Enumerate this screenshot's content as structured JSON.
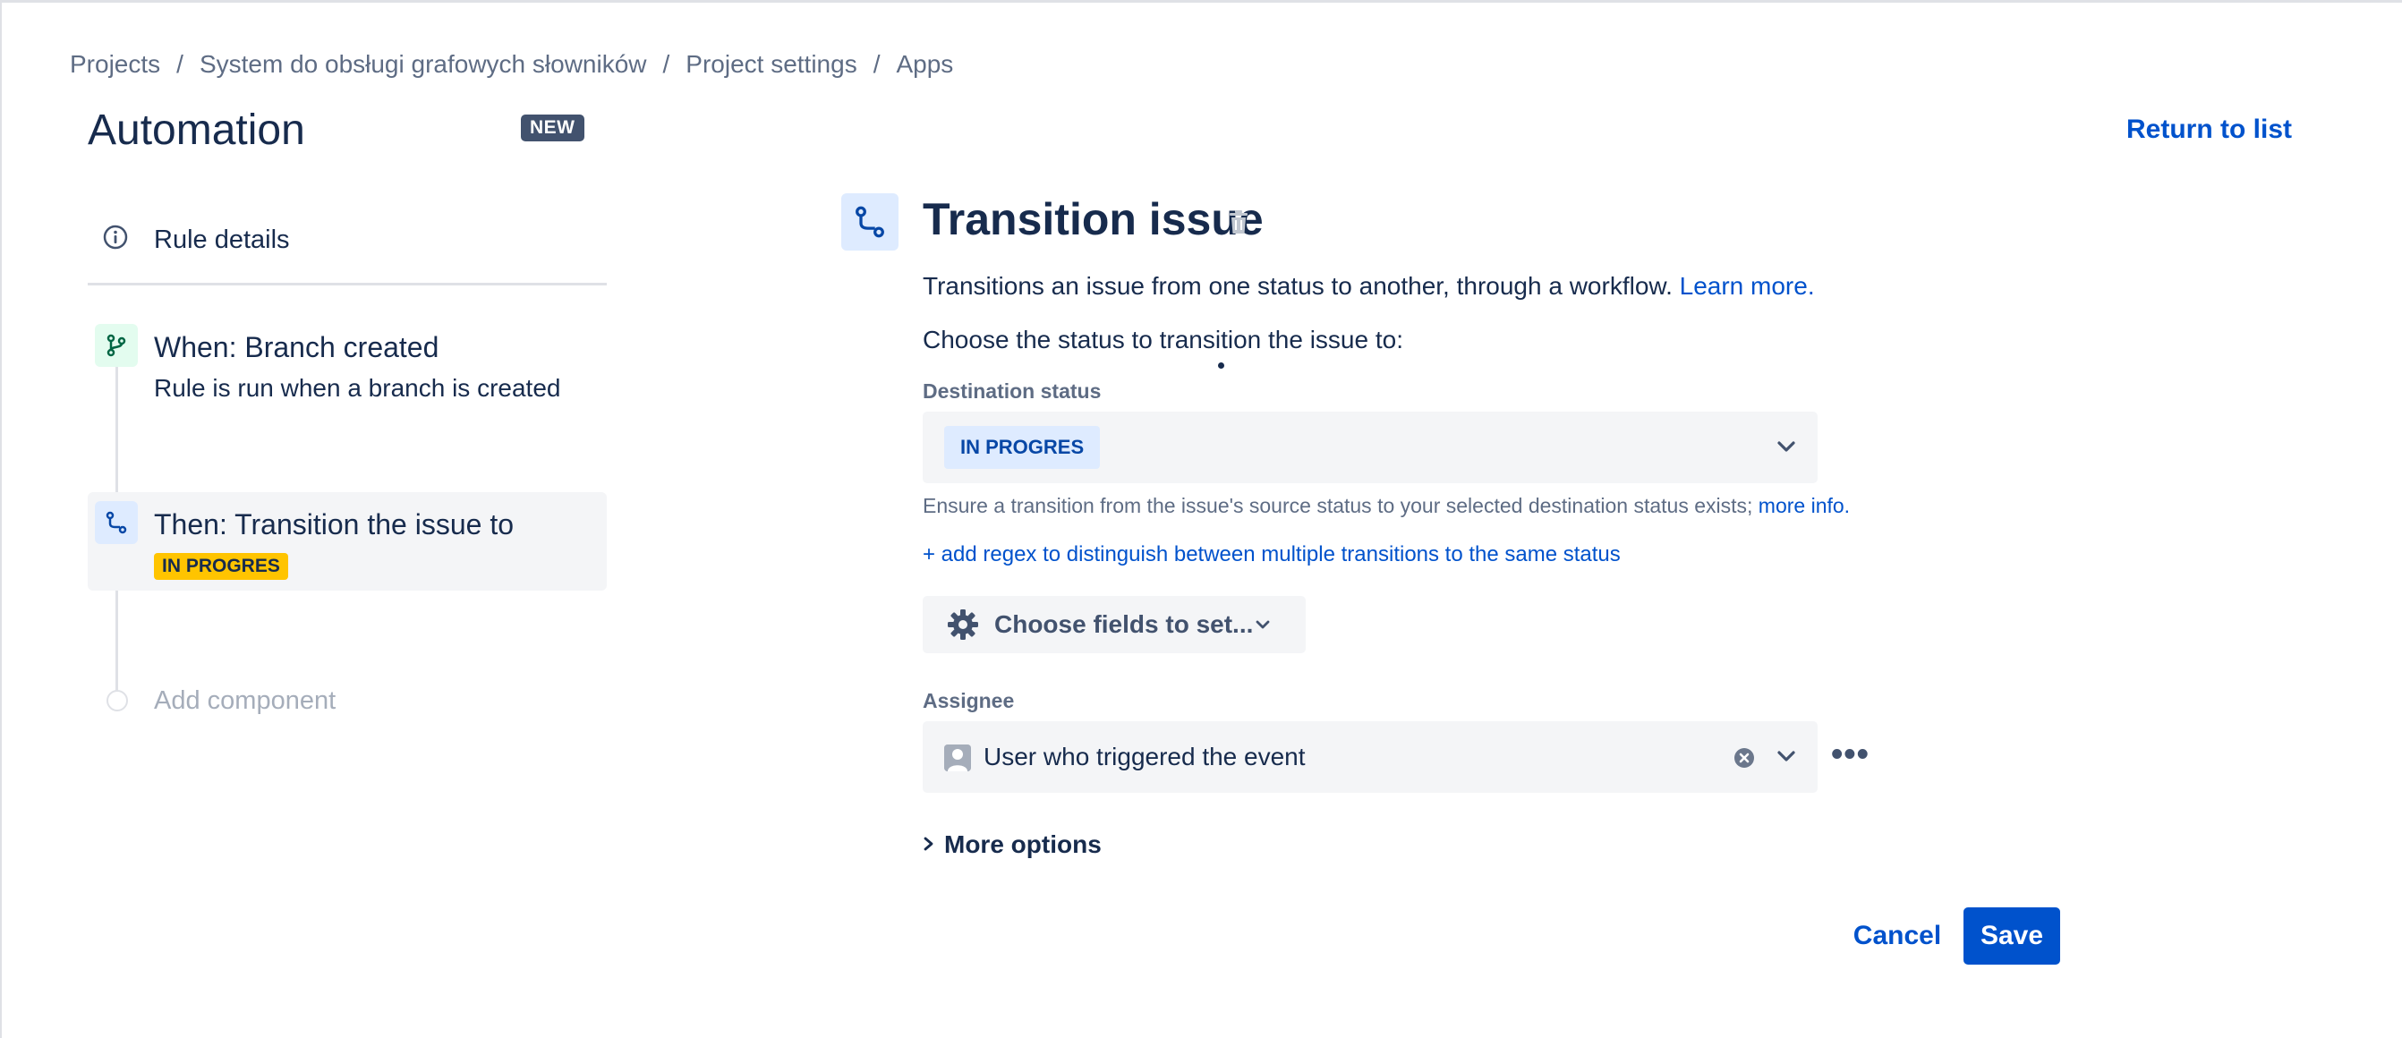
{
  "breadcrumb": {
    "items": [
      "Projects",
      "System do obsługi grafowych słowników",
      "Project settings",
      "Apps"
    ],
    "separator": "/"
  },
  "header": {
    "title": "Automation",
    "badge": "NEW",
    "return_link": "Return to list"
  },
  "sidebar": {
    "rule_details": "Rule details",
    "trigger": {
      "title": "When: Branch created",
      "subtitle": "Rule is run when a branch is created",
      "icon": "branch-icon"
    },
    "action": {
      "title": "Then: Transition the issue to",
      "badge": "IN PROGRES",
      "icon": "transition-icon"
    },
    "add_component": "Add component"
  },
  "panel": {
    "title": "Transition issue",
    "description": "Transitions an issue from one status to another, through a workflow.",
    "learn_more": "Learn more.",
    "choose_label": "Choose the status to transition the issue to:",
    "destination": {
      "label": "Destination status",
      "value": "IN PROGRES"
    },
    "hint": "Ensure a transition from the issue's source status to your selected destination status exists;",
    "hint_link": "more info.",
    "regex_link": "+ add regex to distinguish between multiple transitions to the same status",
    "fields_button": "Choose fields to set...",
    "assignee": {
      "label": "Assignee",
      "value": "User who triggered the event"
    },
    "more_options": "More options",
    "more_dots": "•••"
  },
  "footer": {
    "cancel": "Cancel",
    "save": "Save"
  },
  "colors": {
    "primary": "#0052cc",
    "text": "#172b4d",
    "subtle": "#5e6c84",
    "badge_yellow": "#ffc400",
    "lozenge_blue": "#deebff",
    "trigger_green": "#e3fcef"
  }
}
